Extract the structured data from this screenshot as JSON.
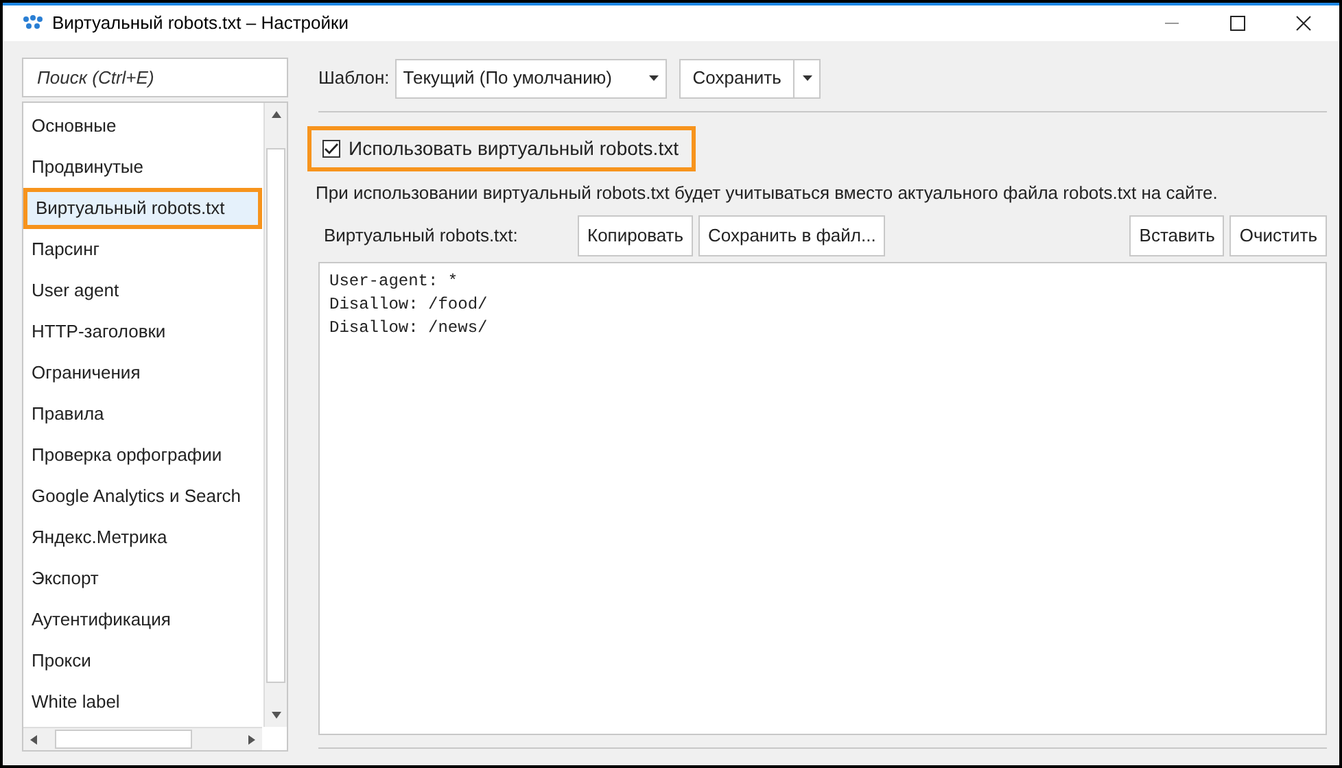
{
  "window": {
    "title": "Виртуальный robots.txt – Настройки"
  },
  "sidebar": {
    "search": {
      "placeholder": "Поиск (Ctrl+E)"
    },
    "items": [
      {
        "label": "Основные",
        "selected": false,
        "highlighted": false
      },
      {
        "label": "Продвинутые",
        "selected": false,
        "highlighted": false
      },
      {
        "label": "Виртуальный robots.txt",
        "selected": true,
        "highlighted": true
      },
      {
        "label": "Парсинг",
        "selected": false,
        "highlighted": false
      },
      {
        "label": "User agent",
        "selected": false,
        "highlighted": false
      },
      {
        "label": "HTTP-заголовки",
        "selected": false,
        "highlighted": false
      },
      {
        "label": "Ограничения",
        "selected": false,
        "highlighted": false
      },
      {
        "label": "Правила",
        "selected": false,
        "highlighted": false
      },
      {
        "label": "Проверка орфографии",
        "selected": false,
        "highlighted": false
      },
      {
        "label": "Google Analytics и Search",
        "selected": false,
        "highlighted": false
      },
      {
        "label": "Яндекс.Метрика",
        "selected": false,
        "highlighted": false
      },
      {
        "label": "Экспорт",
        "selected": false,
        "highlighted": false
      },
      {
        "label": "Аутентификация",
        "selected": false,
        "highlighted": false
      },
      {
        "label": "Прокси",
        "selected": false,
        "highlighted": false
      },
      {
        "label": "White label",
        "selected": false,
        "highlighted": false
      }
    ]
  },
  "template": {
    "label": "Шаблон:",
    "value": "Текущий (По умолчанию)",
    "save_button": "Сохранить"
  },
  "use_virtual": {
    "label": "Использовать виртуальный robots.txt",
    "checked": true,
    "highlighted": true
  },
  "description": "При использовании виртуальный robots.txt будет учитываться вместо актуального файла robots.txt на сайте.",
  "editor": {
    "label": "Виртуальный robots.txt:",
    "left_buttons": [
      "Копировать",
      "Сохранить в файл..."
    ],
    "right_buttons": [
      "Вставить",
      "Очистить"
    ],
    "lines": [
      "User-agent: *",
      "Disallow: /food/",
      "Disallow: /news/"
    ]
  }
}
